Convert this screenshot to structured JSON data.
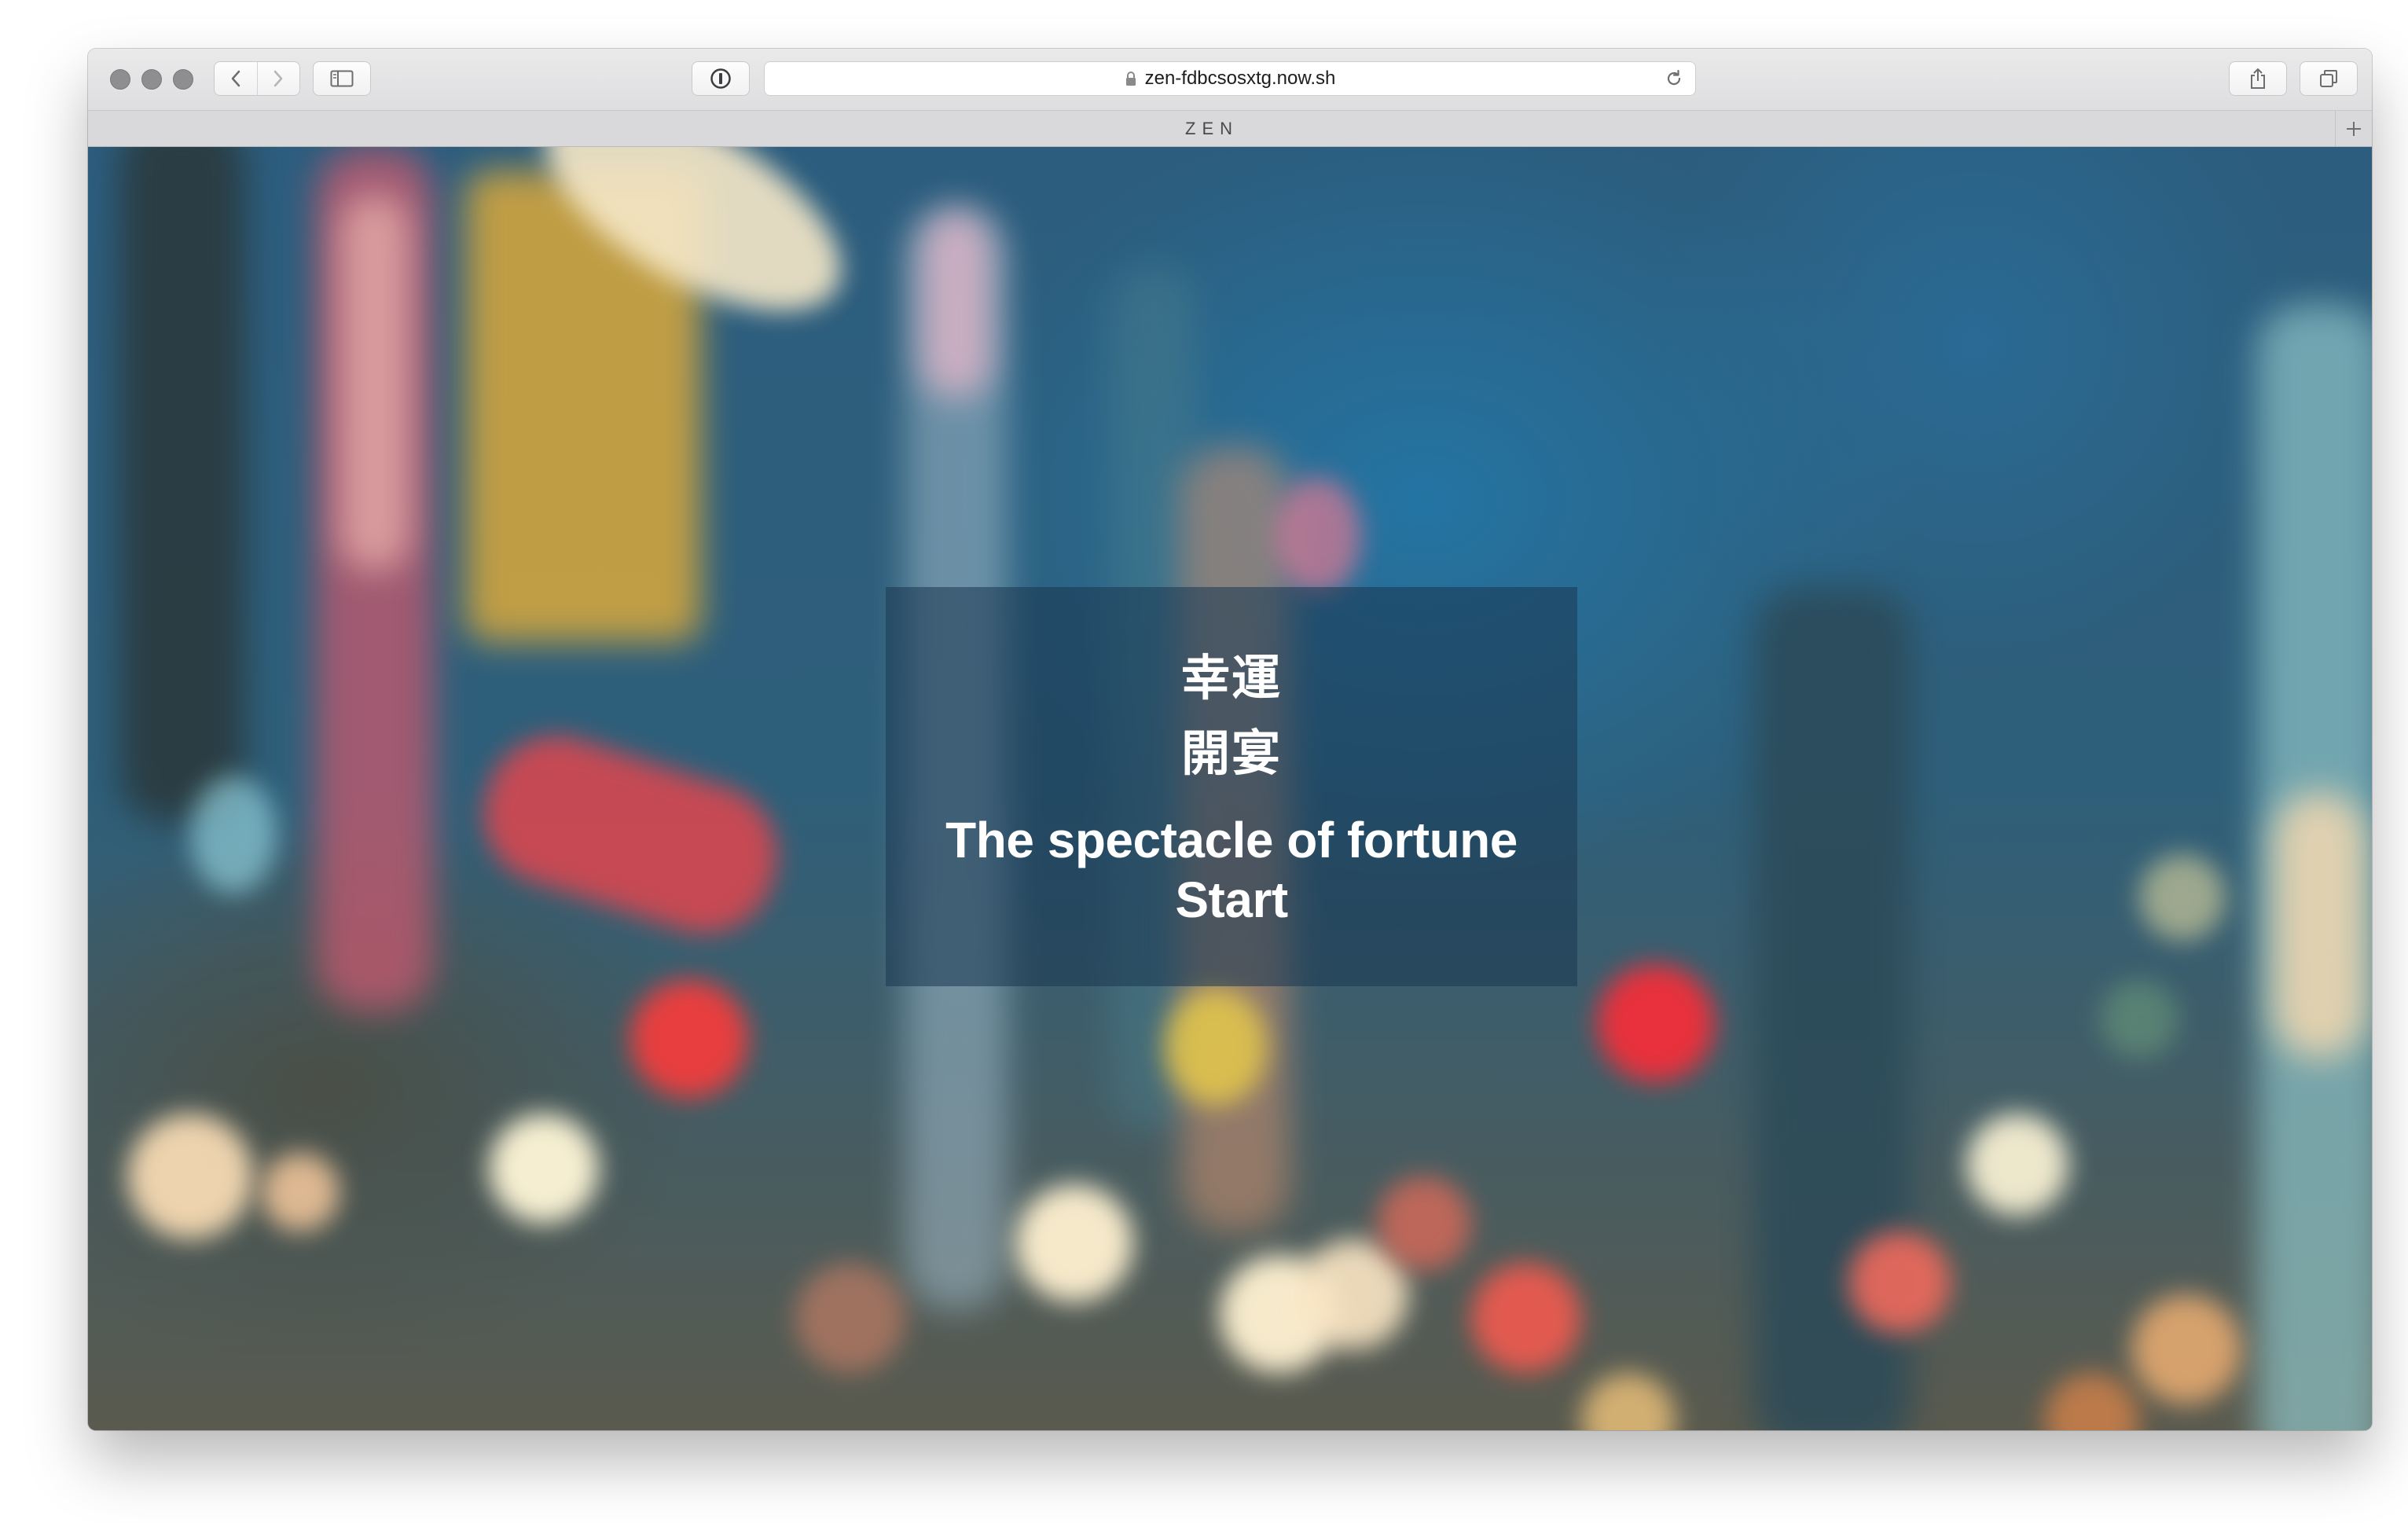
{
  "browser": {
    "url": "zen-fdbcsosxtg.now.sh",
    "tab_title": "ZEN",
    "icons": {
      "close": "traffic-light-close",
      "minimize": "traffic-light-minimize",
      "zoom": "traffic-light-zoom",
      "back": "chevron-left-icon",
      "forward": "chevron-right-icon",
      "sidebar": "sidebar-icon",
      "password": "password-manager-icon",
      "lock": "lock-icon",
      "reload": "reload-icon",
      "share": "share-icon",
      "tabs": "tabs-overview-icon",
      "new_tab": "plus-icon"
    }
  },
  "page": {
    "title_line1": "幸運",
    "title_line2": "開宴",
    "headline": "The spectacle of fortune",
    "start_label": "Start"
  },
  "colors": {
    "overlay": "#193750",
    "text": "#ffffff"
  }
}
